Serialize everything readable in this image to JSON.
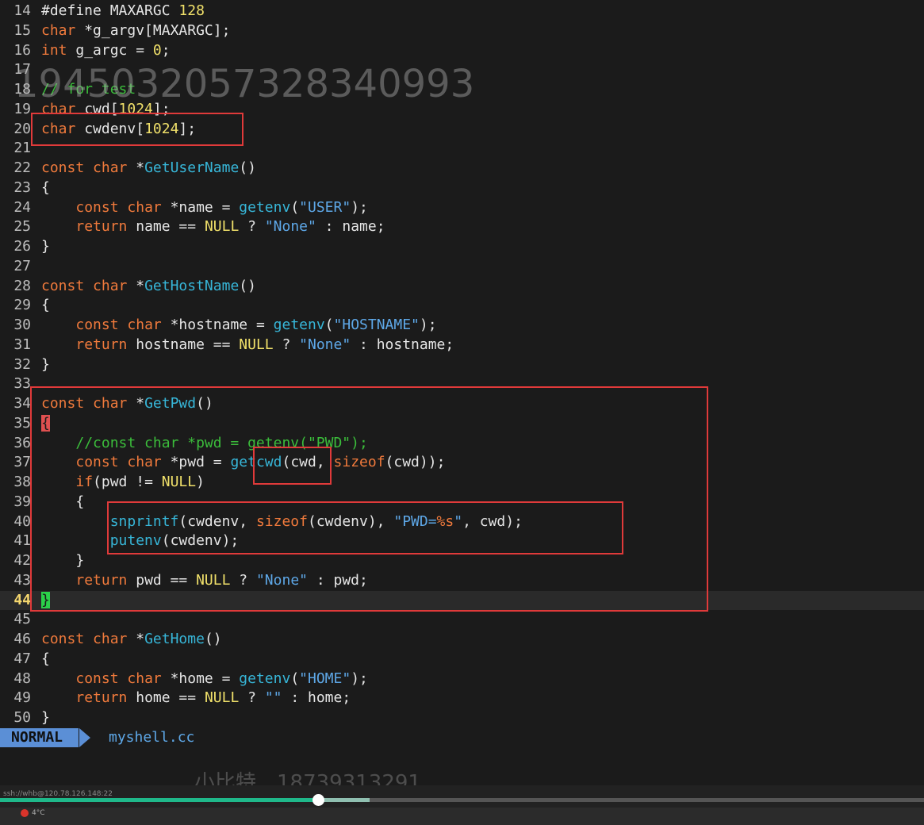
{
  "watermark_top": "1945032057328340993",
  "watermark_bottom": "小比特__18739313291",
  "lines": [
    {
      "n": "14",
      "html": "#define MAXARGC <span class=\"num\">128</span>"
    },
    {
      "n": "15",
      "html": "<span class=\"ty\">char</span> *g_argv[MAXARGC];"
    },
    {
      "n": "16",
      "html": "<span class=\"ty\">int</span> g_argc = <span class=\"num\">0</span>;"
    },
    {
      "n": "17",
      "html": ""
    },
    {
      "n": "18",
      "html": "<span class=\"cmt\">// for test</span>"
    },
    {
      "n": "19",
      "html": "<span class=\"ty\">char</span> cwd[<span class=\"num\">1024</span>];"
    },
    {
      "n": "20",
      "html": "<span class=\"ty\">char</span> cwdenv[<span class=\"num\">1024</span>];"
    },
    {
      "n": "21",
      "html": ""
    },
    {
      "n": "22",
      "html": "<span class=\"kw\">const</span> <span class=\"ty\">char</span> *<span class=\"fn\">GetUserName</span>()"
    },
    {
      "n": "23",
      "html": "{"
    },
    {
      "n": "24",
      "html": "    <span class=\"kw\">const</span> <span class=\"ty\">char</span> *name = <span class=\"fn\">getenv</span>(<span class=\"str\">\"USER\"</span>);"
    },
    {
      "n": "25",
      "html": "    <span class=\"kw\">return</span> name == <span class=\"nul\">NULL</span> ? <span class=\"str\">\"None\"</span> : name;"
    },
    {
      "n": "26",
      "html": "}"
    },
    {
      "n": "27",
      "html": ""
    },
    {
      "n": "28",
      "html": "<span class=\"kw\">const</span> <span class=\"ty\">char</span> *<span class=\"fn\">GetHostName</span>()"
    },
    {
      "n": "29",
      "html": "{"
    },
    {
      "n": "30",
      "html": "    <span class=\"kw\">const</span> <span class=\"ty\">char</span> *hostname = <span class=\"fn\">getenv</span>(<span class=\"str\">\"HOSTNAME\"</span>);"
    },
    {
      "n": "31",
      "html": "    <span class=\"kw\">return</span> hostname == <span class=\"nul\">NULL</span> ? <span class=\"str\">\"None\"</span> : hostname;"
    },
    {
      "n": "32",
      "html": "}"
    },
    {
      "n": "33",
      "html": ""
    },
    {
      "n": "34",
      "html": "<span class=\"kw\">const</span> <span class=\"ty\">char</span> *<span class=\"fn\">GetPwd</span>()"
    },
    {
      "n": "35",
      "html": "<span class=\"brace-red\">{</span>"
    },
    {
      "n": "36",
      "html": "    <span class=\"cmt\">//const char *pwd = getenv(\"PWD\");</span>"
    },
    {
      "n": "37",
      "html": "    <span class=\"kw\">const</span> <span class=\"ty\">char</span> *pwd = <span class=\"fn\">getcwd</span>(cwd, <span class=\"kw\">sizeof</span>(cwd));"
    },
    {
      "n": "38",
      "html": "    <span class=\"kw\">if</span>(pwd != <span class=\"nul\">NULL</span>)"
    },
    {
      "n": "39",
      "html": "    {"
    },
    {
      "n": "40",
      "html": "        <span class=\"fn\">snprintf</span>(cwdenv, <span class=\"kw\">sizeof</span>(cwdenv), <span class=\"str\">\"PWD=</span><span class=\"kw\">%s</span><span class=\"str\">\"</span>, cwd);"
    },
    {
      "n": "41",
      "html": "        <span class=\"fn\">putenv</span>(cwdenv);"
    },
    {
      "n": "42",
      "html": "    }"
    },
    {
      "n": "43",
      "html": "    <span class=\"kw\">return</span> pwd == <span class=\"nul\">NULL</span> ? <span class=\"str\">\"None\"</span> : pwd;"
    },
    {
      "n": "44",
      "html": "<span class=\"brace-green\">}</span>",
      "current": true
    },
    {
      "n": "45",
      "html": ""
    },
    {
      "n": "46",
      "html": "<span class=\"kw\">const</span> <span class=\"ty\">char</span> *<span class=\"fn\">GetHome</span>()"
    },
    {
      "n": "47",
      "html": "{"
    },
    {
      "n": "48",
      "html": "    <span class=\"kw\">const</span> <span class=\"ty\">char</span> *home = <span class=\"fn\">getenv</span>(<span class=\"str\">\"HOME\"</span>);"
    },
    {
      "n": "49",
      "html": "    <span class=\"kw\">return</span> home == <span class=\"nul\">NULL</span> ? <span class=\"str\">\"\"</span> : home;"
    },
    {
      "n": "50",
      "html": "}"
    }
  ],
  "status": {
    "mode": "NORMAL",
    "filename": "myshell.cc"
  },
  "video": {
    "ssh_title": "ssh://whb@120.78.126.148:22",
    "progress_fraction": 0.344,
    "weather": "4°C"
  },
  "colors": {
    "highlight_box": "#e03a3a",
    "mode_bg": "#5b8fd6",
    "progress": "#1fb88a"
  }
}
